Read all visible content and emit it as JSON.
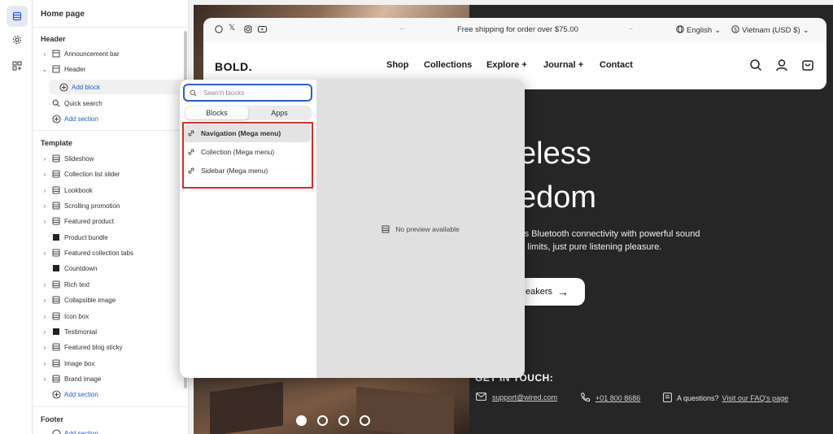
{
  "sidebar": {
    "title": "Home page",
    "groups": {
      "header": "Header",
      "template": "Template",
      "footer": "Footer"
    },
    "header_items": [
      {
        "label": "Announcement bar",
        "icon": "layout-icon"
      },
      {
        "label": "Header",
        "icon": "layout-icon"
      }
    ],
    "add_block": "Add block",
    "quick_search": "Quick search",
    "add_section": "Add section",
    "template_items": [
      {
        "label": "Slideshow"
      },
      {
        "label": "Collection list slider"
      },
      {
        "label": "Lookbook"
      },
      {
        "label": "Scrolling promotion"
      },
      {
        "label": "Featured product"
      },
      {
        "label": "Product bundle"
      },
      {
        "label": "Featured collection tabs"
      },
      {
        "label": "Countdown"
      },
      {
        "label": "Rich text"
      },
      {
        "label": "Collapsible image"
      },
      {
        "label": "Icon box"
      },
      {
        "label": "Testimonial"
      },
      {
        "label": "Featured blog sticky"
      },
      {
        "label": "Image box"
      },
      {
        "label": "Brand image"
      }
    ]
  },
  "popup": {
    "search_placeholder": "Search blocks",
    "tabs": [
      "Blocks",
      "Apps"
    ],
    "blocks": [
      "Navigation (Mega menu)",
      "Collection (Mega menu)",
      "Sidebar (Mega menu)"
    ],
    "preview_text": "No preview available"
  },
  "store": {
    "announcement": "Free shipping for order over $75.00",
    "language": "English",
    "currency": "Vietnam (USD $)",
    "logo": "BOLD.",
    "nav": [
      "Shop",
      "Collections",
      "Explore +",
      "Journal +",
      "Contact"
    ],
    "hero_line1": "eless",
    "hero_line2": "edom",
    "hero_sub1": "ess Bluetooth connectivity with powerful sound",
    "hero_sub2": "no limits, just pure listening pleasure.",
    "hero_button": "eakers",
    "get_in_touch": "GET IN TOUCH:",
    "email": "support@wired.com",
    "phone": "+01 800 8686",
    "questions": "A questions?",
    "faq_link": "Visit our FAQ's page"
  },
  "colors": {
    "accent": "#2a5bd7",
    "highlight": "#d82c2c"
  }
}
